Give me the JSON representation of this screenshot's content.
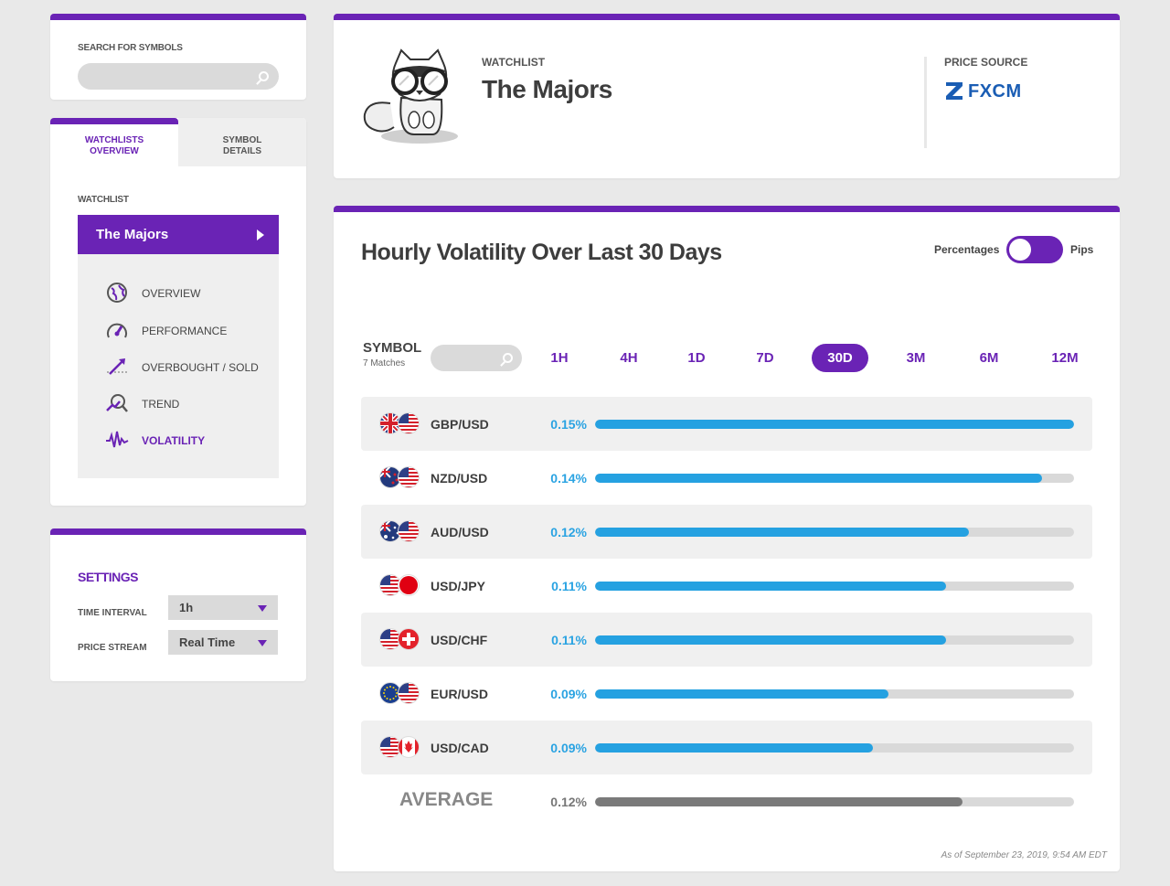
{
  "search": {
    "label": "SEARCH FOR SYMBOLS",
    "placeholder": ""
  },
  "nav": {
    "tabs": [
      {
        "line1": "WATCHLISTS",
        "line2": "OVERVIEW",
        "active": true
      },
      {
        "line1": "SYMBOL",
        "line2": "DETAILS",
        "active": false
      }
    ],
    "watchlist_label": "WATCHLIST",
    "watchlist_value": "The Majors",
    "items": [
      {
        "label": "OVERVIEW",
        "icon": "globe-icon",
        "active": false
      },
      {
        "label": "PERFORMANCE",
        "icon": "speedometer-icon",
        "active": false
      },
      {
        "label": "OVERBOUGHT / SOLD",
        "icon": "trend-arrow-icon",
        "active": false
      },
      {
        "label": "TREND",
        "icon": "magnifier-trend-icon",
        "active": false
      },
      {
        "label": "VOLATILITY",
        "icon": "pulse-icon",
        "active": true
      }
    ]
  },
  "settings": {
    "title": "SETTINGS",
    "time_interval_label": "TIME INTERVAL",
    "time_interval_value": "1h",
    "price_stream_label": "PRICE STREAM",
    "price_stream_value": "Real Time"
  },
  "header": {
    "watchlist_label": "WATCHLIST",
    "watchlist_title": "The Majors",
    "price_source_label": "PRICE SOURCE",
    "price_source_logo": "FXCM"
  },
  "main": {
    "title": "Hourly Volatility Over Last 30 Days",
    "toggle_left": "Percentages",
    "toggle_right": "Pips",
    "symbol_label": "SYMBOL",
    "matches": "7 Matches",
    "ranges": [
      "1H",
      "4H",
      "1D",
      "7D",
      "30D",
      "3M",
      "6M",
      "12M"
    ],
    "active_range": "30D",
    "as_of": "As of September 23, 2019, 9:54 AM EDT"
  },
  "colors": {
    "accent": "#6a23b5",
    "bar": "#25a1e1",
    "value_text": "#2aa3e2",
    "average_bar": "#7a7a7a"
  },
  "chart_data": {
    "type": "bar",
    "categories": [
      "GBP/USD",
      "NZD/USD",
      "AUD/USD",
      "USD/JPY",
      "USD/CHF",
      "EUR/USD",
      "USD/CAD"
    ],
    "value_labels": [
      "0.15%",
      "0.14%",
      "0.12%",
      "0.11%",
      "0.11%",
      "0.09%",
      "0.09%"
    ],
    "values": [
      0.15,
      0.14,
      0.117,
      0.11,
      0.11,
      0.092,
      0.087
    ],
    "flags": [
      [
        "uk",
        "us"
      ],
      [
        "nz",
        "us"
      ],
      [
        "au",
        "us"
      ],
      [
        "us",
        "jp"
      ],
      [
        "us",
        "ch"
      ],
      [
        "eu",
        "us"
      ],
      [
        "us",
        "ca"
      ]
    ],
    "average": {
      "label": "AVERAGE",
      "value_label": "0.12%",
      "value": 0.115
    },
    "xlim": [
      0,
      0.15
    ],
    "title": "Hourly Volatility Over Last 30 Days"
  }
}
